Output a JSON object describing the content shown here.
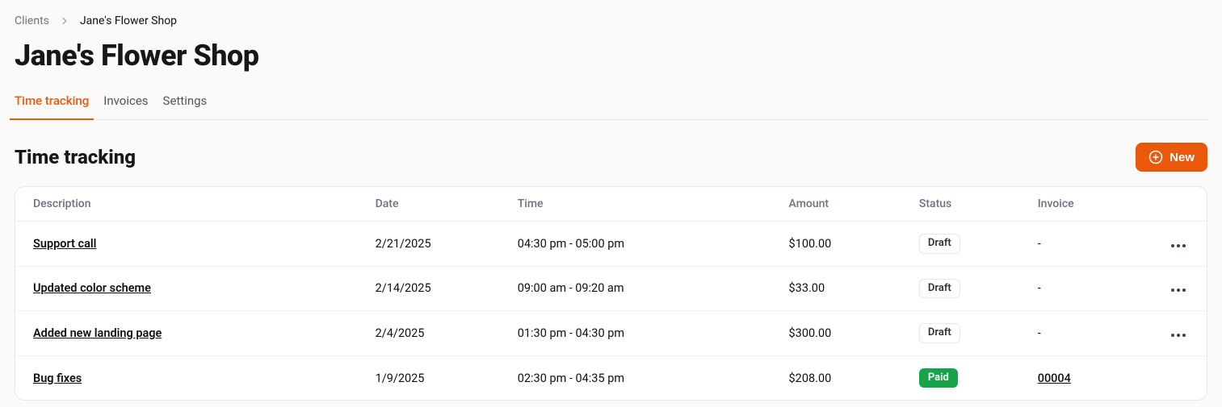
{
  "breadcrumb": {
    "root": "Clients",
    "current": "Jane's Flower Shop"
  },
  "page_title": "Jane's Flower Shop",
  "tabs": [
    {
      "label": "Time tracking",
      "active": true
    },
    {
      "label": "Invoices",
      "active": false
    },
    {
      "label": "Settings",
      "active": false
    }
  ],
  "section": {
    "title": "Time tracking",
    "new_button_label": "New"
  },
  "table": {
    "headers": {
      "description": "Description",
      "date": "Date",
      "time": "Time",
      "amount": "Amount",
      "status": "Status",
      "invoice": "Invoice"
    },
    "rows": [
      {
        "description": "Support call",
        "date": "2/21/2025",
        "time": "04:30 pm - 05:00 pm",
        "amount": "$100.00",
        "status": "Draft",
        "status_kind": "draft",
        "invoice": "-",
        "has_actions": true
      },
      {
        "description": "Updated color scheme",
        "date": "2/14/2025",
        "time": "09:00 am - 09:20 am",
        "amount": "$33.00",
        "status": "Draft",
        "status_kind": "draft",
        "invoice": "-",
        "has_actions": true
      },
      {
        "description": "Added new landing page",
        "date": "2/4/2025",
        "time": "01:30 pm - 04:30 pm",
        "amount": "$300.00",
        "status": "Draft",
        "status_kind": "draft",
        "invoice": "-",
        "has_actions": true
      },
      {
        "description": "Bug fixes",
        "date": "1/9/2025",
        "time": "02:30 pm - 04:35 pm",
        "amount": "$208.00",
        "status": "Paid",
        "status_kind": "paid",
        "invoice": "00004",
        "has_actions": false
      }
    ]
  }
}
